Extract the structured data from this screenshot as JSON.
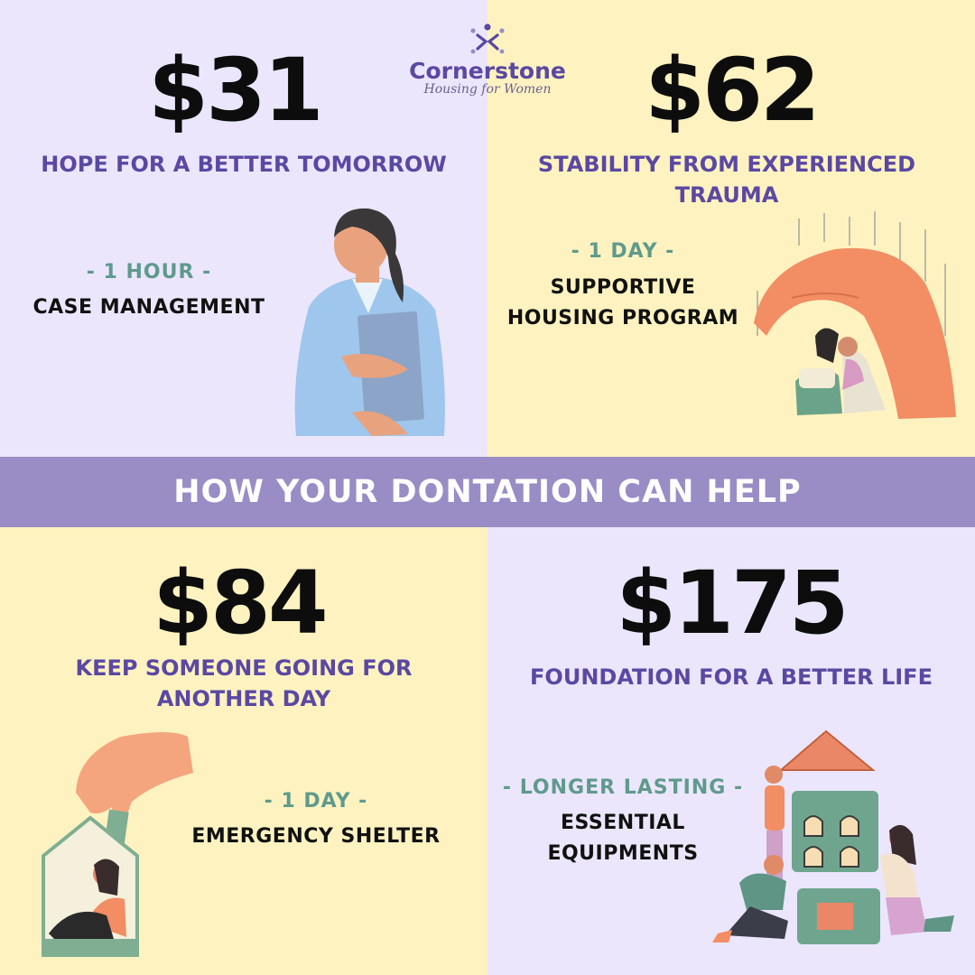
{
  "logo": {
    "name": "Cornerstone",
    "subtitle": "Housing for Women"
  },
  "banner": "HOW YOUR DONTATION CAN HELP",
  "cards": [
    {
      "price": "$31",
      "tagline": "HOPE FOR A BETTER TOMORROW",
      "duration": "- 1 HOUR -",
      "program": [
        "CASE MANAGEMENT"
      ]
    },
    {
      "price": "$62",
      "tagline": "STABILITY FROM EXPERIENCED TRAUMA",
      "duration": "- 1 DAY -",
      "program": [
        "SUPPORTIVE",
        "HOUSING PROGRAM"
      ]
    },
    {
      "price": "$84",
      "tagline": [
        "KEEP SOMEONE GOING FOR",
        "ANOTHER DAY"
      ],
      "duration": "- 1 DAY -",
      "program": [
        "EMERGENCY SHELTER"
      ]
    },
    {
      "price": "$175",
      "tagline": "FOUNDATION FOR A BETTER LIFE",
      "duration": "- LONGER LASTING -",
      "program": [
        "ESSENTIAL",
        "EQUIPMENTS"
      ]
    }
  ],
  "colors": {
    "lavender": "#ebe6fb",
    "cream": "#fef3c0",
    "banner": "#9a8cc5",
    "purple_text": "#5b48a2",
    "teal_text": "#5f9a8c"
  }
}
